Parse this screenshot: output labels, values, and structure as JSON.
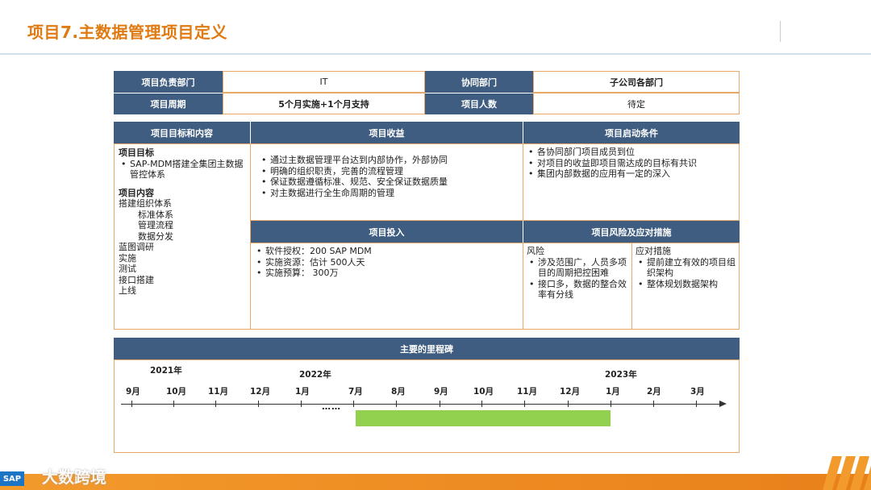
{
  "page": {
    "title": "项目7.主数据管理项目定义"
  },
  "info_table": {
    "dept_label": "项目负责部门",
    "dept_value": "IT",
    "coop_label": "协同部门",
    "coop_value": "子公司各部门",
    "period_label": "项目周期",
    "period_value": "5个月实施+1个月支持",
    "people_label": "项目人数",
    "people_value": "待定"
  },
  "goals": {
    "header": "项目目标和内容",
    "goal_title": "项目目标",
    "goal_item": "SAP-MDM搭建全集团主数据管控体系",
    "content_title": "项目内容",
    "content_lines": [
      "搭建组织体系",
      "标准体系",
      "管理流程",
      "数据分发",
      "蓝图调研",
      "实施",
      "测试",
      "接口搭建",
      "上线"
    ]
  },
  "benefits": {
    "header": "项目收益",
    "items": [
      "通过主数据管理平台达到内部协作，外部协同",
      "明确的组织职责，完善的流程管理",
      "保证数据遵循标准、规范、安全保证数据质量",
      "对主数据进行全生命周期的管理"
    ]
  },
  "startup": {
    "header": "项目启动条件",
    "items": [
      "各协同部门项目成员到位",
      "对项目的收益即项目需达成的目标有共识",
      "集团内部数据的应用有一定的深入"
    ]
  },
  "investment": {
    "header": "项目投入",
    "items": [
      "软件授权：200 SAP MDM",
      "实施资源：估计 500人天",
      "实施预算：  300万"
    ]
  },
  "risk": {
    "header": "项目风险及应对措施",
    "risk_title": "风险",
    "risk_items": [
      "涉及范围广，人员多项目的周期把控困难",
      "接口多，数据的整合效率有分线"
    ],
    "measure_title": "应对措施",
    "measure_items": [
      "提前建立有效的项目组织架构",
      "整体规划数据架构"
    ]
  },
  "milestone": {
    "header": "主要的里程碑",
    "years": [
      "2021年",
      "2022年",
      "2023年"
    ],
    "months_a": [
      "9月",
      "10月",
      "11月",
      "12月",
      "1月"
    ],
    "months_b": [
      "7月",
      "8月",
      "9月",
      "10月",
      "11月",
      "12月",
      "1月",
      "2月",
      "3月"
    ],
    "ellipsis": "……"
  },
  "footer": {
    "sap_logo": "SAP",
    "watermark": "大数跨境"
  },
  "colors": {
    "header_bg": "#3f5d80",
    "border": "#e8a868",
    "title": "#e07a12",
    "bar": "#92d050"
  }
}
